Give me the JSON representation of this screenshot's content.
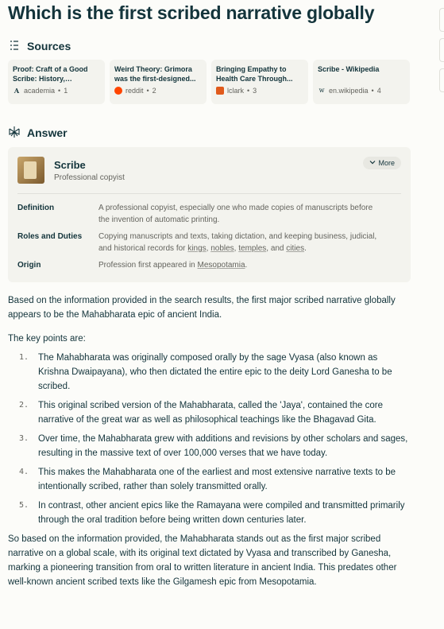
{
  "title": "Which is the first scribed narrative globally",
  "sources": {
    "heading": "Sources",
    "icon": "stack-icon",
    "items": [
      {
        "title": "Proof: Craft of a Good Scribe: History, Narrative...",
        "site": "academia",
        "index": "1",
        "icon": "academia-icon"
      },
      {
        "title": "Weird Theory: Grimora was the first-designed...",
        "site": "reddit",
        "index": "2",
        "icon": "reddit-icon"
      },
      {
        "title": "Bringing Empathy to Health Care Through...",
        "site": "lclark",
        "index": "3",
        "icon": "lclark-icon"
      },
      {
        "title": "Scribe - Wikipedia",
        "site": "en.wikipedia",
        "index": "4",
        "icon": "wikipedia-icon"
      }
    ]
  },
  "answer": {
    "heading": "Answer",
    "icon": "perplexity-icon",
    "knowledge_card": {
      "name": "Scribe",
      "subtitle": "Professional copyist",
      "more_label": "More",
      "rows": [
        {
          "label": "Definition",
          "value": "A professional copyist, especially one who made copies of manuscripts before the invention of automatic printing."
        },
        {
          "label": "Roles and Duties",
          "value_prefix": "Copying manuscripts and texts, taking dictation, and keeping business, judicial, and historical records for ",
          "links": [
            "kings",
            "nobles",
            "temples"
          ],
          "and": "and",
          "last_link": "cities",
          "suffix": "."
        },
        {
          "label": "Origin",
          "value_prefix": "Profession first appeared in ",
          "link": "Mesopotamia",
          "suffix": "."
        }
      ]
    },
    "intro": "Based on the information provided in the search results, the first major scribed narrative globally appears to be the Mahabharata epic of ancient India.",
    "key_points_label": "The key points are:",
    "points": [
      {
        "n": "1.",
        "text": "The Mahabharata was originally composed orally by the sage Vyasa (also known as Krishna Dwaipayana), who then dictated the entire epic to the deity Lord Ganesha to be scribed."
      },
      {
        "n": "2.",
        "text": "This original scribed version of the Mahabharata, called the 'Jaya', contained the core narrative of the great war as well as philosophical teachings like the Bhagavad Gita."
      },
      {
        "n": "3.",
        "text": "Over time, the Mahabharata grew with additions and revisions by other scholars and sages, resulting in the massive text of over 100,000 verses that we have today."
      },
      {
        "n": "4.",
        "text": "This makes the Mahabharata one of the earliest and most extensive narrative texts to be intentionally scribed, rather than solely transmitted orally."
      },
      {
        "n": "5.",
        "text": "In contrast, other ancient epics like the Ramayana were compiled and transmitted primarily through the oral tradition before being written down centuries later."
      }
    ],
    "conclusion": "So based on the information provided, the Mahabharata stands out as the first major scribed narrative on a global scale, with its original text dictated by Vyasa and transcribed by Ganesha, marking a pioneering transition from oral to written literature in ancient India. This predates other well-known ancient scribed texts like the Gilgamesh epic from Mesopotamia."
  },
  "colors": {
    "text": "#13343b",
    "muted": "#64645e",
    "card_bg": "#f3f3ee",
    "page_bg": "#fcfcf9"
  }
}
